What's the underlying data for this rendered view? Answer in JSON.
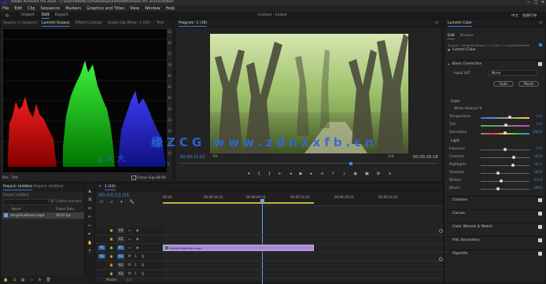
{
  "titlebar": {
    "title": "Adobe Premiere Pro 2016 - C:\\Users\\MONSTER\\Desktop\\Untitled\\Premiere Pro 2016\\Untitled",
    "minimize": "—",
    "maximize": "□",
    "close": "✕"
  },
  "menu": [
    "File",
    "Edit",
    "Clip",
    "Sequence",
    "Markers",
    "Graphics and Titles",
    "View",
    "Window",
    "Help"
  ],
  "workspaces": {
    "home_icon": "home-icon",
    "tabs": [
      "Import",
      "Edit",
      "Export"
    ],
    "active": "Edit",
    "header_title": "Untitled - Edited"
  },
  "workspace_right": {
    "lang": "中文",
    "label": "拍摄引导"
  },
  "scopes": {
    "tabs": [
      "Source: 1 (Scopes)",
      "Lumetri Scopes",
      "Effect Controls",
      "Audio Clip Mixer: 1 (16)",
      "Text"
    ],
    "active_tab": "Lumetri Scopes",
    "scale_right": [
      "65",
      "60",
      "55",
      "50",
      "45",
      "40",
      "35",
      "30",
      "25",
      "20",
      "15",
      "10",
      "5",
      "0"
    ],
    "footer_left": "Rec. 709",
    "footer_right": "8 Bit",
    "clamp_label": "Clamp Signal"
  },
  "program": {
    "tabs": [
      "Program: 1 (16)"
    ],
    "timecode": "00:00:11:01",
    "fit": "Fit",
    "full": "1/4",
    "duration": "00:00:16:18"
  },
  "lumetri": {
    "tabs": [
      "Edit",
      "Browse"
    ],
    "title": "Lumetri Color",
    "clip": "Source • nhnytirlusfineari   >   1 (16) • n rhnytirlusfineari",
    "master": "Lumetri Color",
    "basic": "Basic Correction",
    "input_lut": "Input LUT",
    "input_lut_val": "None",
    "auto": "Auto",
    "reset": "Reset",
    "color_hdr": "Color",
    "white_balance": "White Balance",
    "light_hdr": "Light",
    "sliders": [
      {
        "label": "Temperature",
        "value": "0.0",
        "pos": 0.6
      },
      {
        "label": "Tint",
        "value": "0.0",
        "pos": 0.52
      },
      {
        "label": "Saturation",
        "value": "100.0",
        "pos": 0.5
      },
      {
        "label": "Exposure",
        "value": "0.0",
        "pos": 0.5
      },
      {
        "label": "Contrast",
        "value": "35.0",
        "pos": 0.68
      },
      {
        "label": "Highlights",
        "value": "32.2",
        "pos": 0.66
      },
      {
        "label": "Shadows",
        "value": "-28.0",
        "pos": 0.36
      },
      {
        "label": "Whites",
        "value": "-14.0",
        "pos": 0.42
      },
      {
        "label": "Blacks",
        "value": "-28.0",
        "pos": 0.36
      }
    ],
    "sections": [
      "Creative",
      "Curves",
      "Color Wheels & Match",
      "HSL Secondary",
      "Vignette"
    ]
  },
  "project": {
    "tabs": [
      "Project: Untitled",
      "Project: Untitled"
    ],
    "search_placeholder": "",
    "name_col": "Name",
    "fps_col": "Frame Rate",
    "count": "1 of 1 items selected",
    "item": "nhnytirlusfineari.mp4",
    "item_fps": "29.97 fps"
  },
  "timeline": {
    "tab": "1 (16)",
    "timecode": "00:00:11:01",
    "ruler": [
      "00:00",
      "00:00:04:23",
      "00:00:09:23",
      "00:00:14:23",
      "00:00:19:23",
      "00:00:24:23"
    ],
    "video_tracks": [
      "V3",
      "V2",
      "V1"
    ],
    "audio_tracks": [
      "A1",
      "A2",
      "A3"
    ],
    "master": "Master",
    "master_val": "0.0",
    "clip_label": "nhnytirlusfineari.mp4"
  },
  "watermark": "缘ZCG  www.zdnxxfb.cn",
  "colors": {
    "accent": "#3b7bd8",
    "clip": "#a889d8",
    "timecode": "#3b8de0"
  }
}
